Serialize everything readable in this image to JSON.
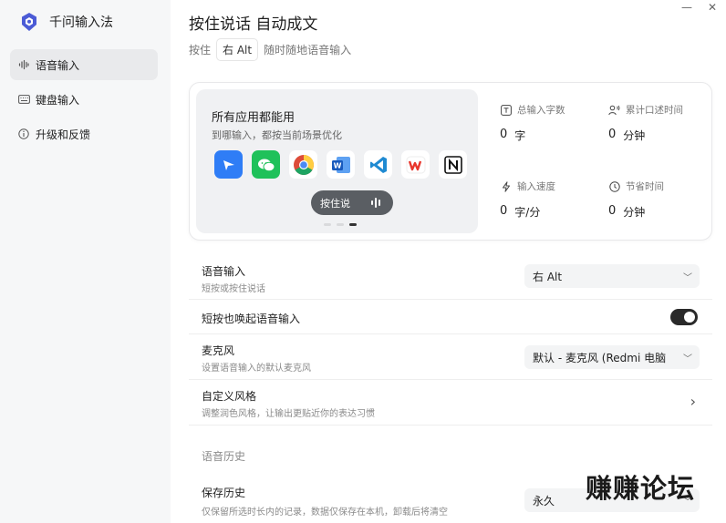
{
  "app": {
    "name": "千问输入法"
  },
  "sidebar": {
    "items": [
      {
        "label": "语音输入",
        "icon": "voice-wave-icon",
        "active": true
      },
      {
        "label": "键盘输入",
        "icon": "keyboard-icon",
        "active": false
      },
      {
        "label": "升级和反馈",
        "icon": "info-icon",
        "active": false
      }
    ]
  },
  "window": {
    "minimize": "—",
    "close": "✕"
  },
  "header": {
    "title": "按住说话 自动成文",
    "subtitle_prefix": "按住",
    "subtitle_key": "右 Alt",
    "subtitle_suffix": "随时随地语音输入"
  },
  "promo": {
    "title": "所有应用都能用",
    "subtitle": "到哪输入，都按当前场景优化",
    "apps": [
      "feishu-app-icon",
      "wechat-app-icon",
      "chrome-app-icon",
      "word-app-icon",
      "vscode-app-icon",
      "wps-app-icon",
      "notion-app-icon"
    ],
    "pill_label": "按住说"
  },
  "stats": [
    {
      "label": "总输入字数",
      "value": "0",
      "unit": "字",
      "icon": "text-box-icon"
    },
    {
      "label": "累计口述时间",
      "value": "0",
      "unit": "分钟",
      "icon": "speaker-person-icon"
    },
    {
      "label": "输入速度",
      "value": "0",
      "unit": "字/分",
      "icon": "lightning-icon"
    },
    {
      "label": "节省时间",
      "value": "0",
      "unit": "分钟",
      "icon": "clock-icon"
    }
  ],
  "settings": {
    "voice_input": {
      "title": "语音输入",
      "desc": "短按或按住说话",
      "value": "右 Alt"
    },
    "short_press": {
      "title": "短按也唤起语音输入",
      "enabled": true
    },
    "microphone": {
      "title": "麦克风",
      "desc": "设置语音输入的默认麦克风",
      "value": "默认 - 麦克风 (Redmi 电脑"
    },
    "custom_style": {
      "title": "自定义风格",
      "desc": "调整润色风格，让输出更贴近你的表达习惯"
    },
    "history_section": "语音历史",
    "save_history": {
      "title": "保存历史",
      "desc": "仅保留所选时长内的记录，数据仅保存在本机，卸载后将清空",
      "value": "永久"
    }
  },
  "watermark": "赚赚论坛",
  "colors": {
    "accent": "#3b5bdb",
    "toggle_on": "#2a2a2a",
    "sidebar_bg": "#f6f7f8"
  }
}
